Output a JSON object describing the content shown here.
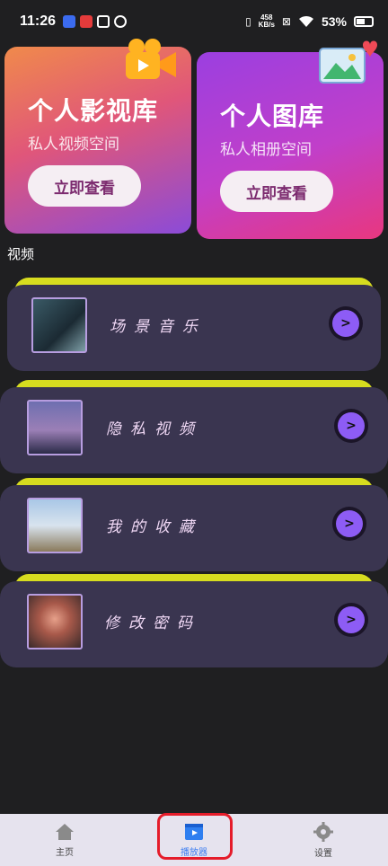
{
  "status_bar": {
    "time": "11:26",
    "net_speed_value": "458",
    "net_speed_unit": "KB/s",
    "battery": "53%"
  },
  "cards": {
    "video": {
      "title": "个人影视库",
      "subtitle": "私人视频空间",
      "button": "立即查看"
    },
    "photo": {
      "title": "个人图库",
      "subtitle": "私人相册空间",
      "button": "立即查看"
    }
  },
  "section": {
    "title": "视频"
  },
  "list": [
    {
      "label": "场景音乐"
    },
    {
      "label": "隐私视频"
    },
    {
      "label": "我的收藏"
    },
    {
      "label": "修改密码"
    }
  ],
  "nav": {
    "home": "主页",
    "player": "播放器",
    "settings": "设置"
  },
  "colors": {
    "accent": "#8d5cf5",
    "lip": "#d7dc1f",
    "panel": "#3a3550",
    "active_tab": "#3d7df0",
    "highlight": "#e51c2a"
  }
}
